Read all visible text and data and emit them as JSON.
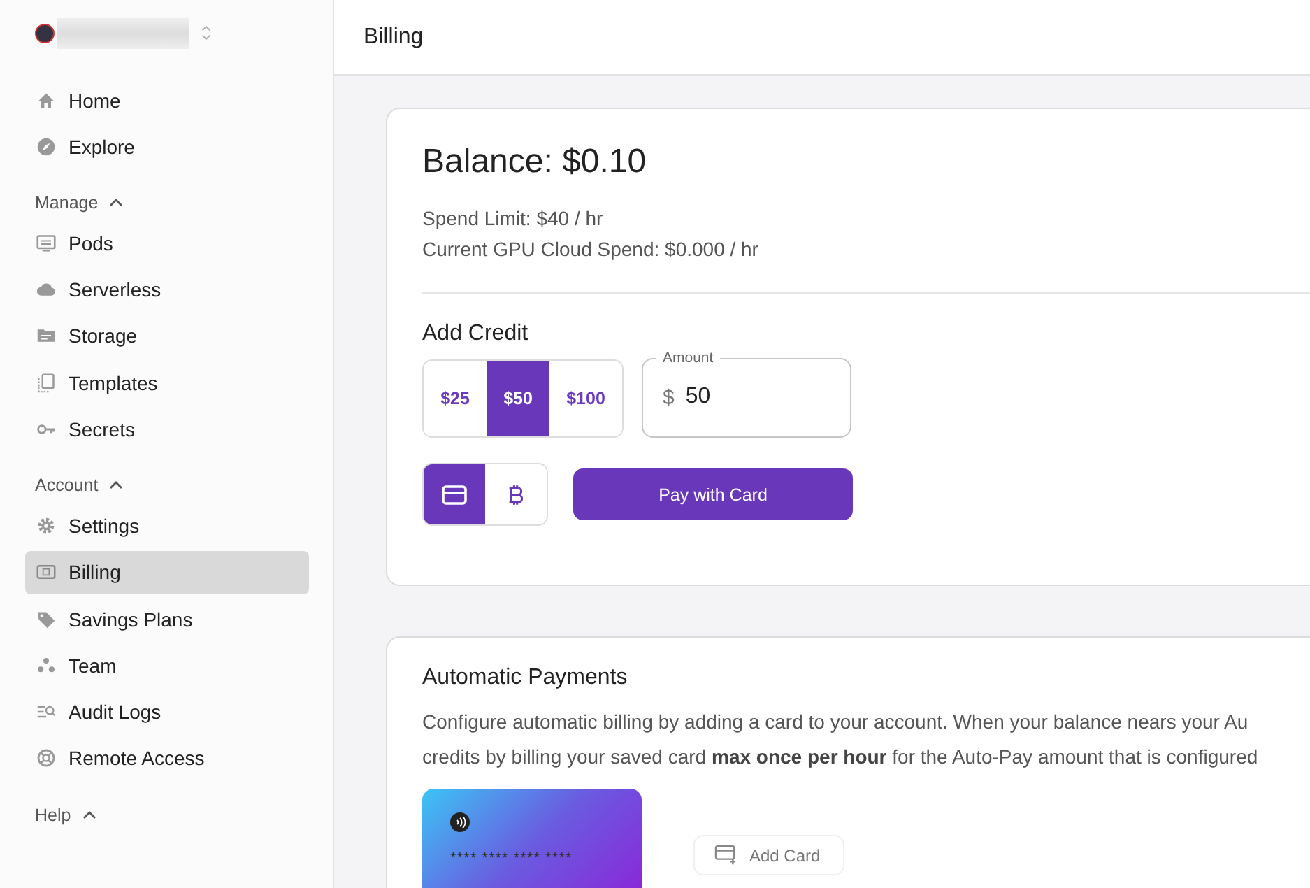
{
  "sidebar": {
    "top_items": [
      {
        "label": "Home",
        "selected": false
      },
      {
        "label": "Explore",
        "selected": false
      }
    ],
    "sections": [
      {
        "title": "Manage",
        "expanded": true,
        "items": [
          {
            "label": "Pods",
            "selected": false
          },
          {
            "label": "Serverless",
            "selected": false
          },
          {
            "label": "Storage",
            "selected": false
          },
          {
            "label": "Templates",
            "selected": false
          },
          {
            "label": "Secrets",
            "selected": false
          }
        ]
      },
      {
        "title": "Account",
        "expanded": true,
        "items": [
          {
            "label": "Settings",
            "selected": false
          },
          {
            "label": "Billing",
            "selected": true
          },
          {
            "label": "Savings Plans",
            "selected": false
          },
          {
            "label": "Team",
            "selected": false
          },
          {
            "label": "Audit Logs",
            "selected": false
          },
          {
            "label": "Remote Access",
            "selected": false
          }
        ]
      },
      {
        "title": "Help",
        "expanded": true
      }
    ]
  },
  "header": {
    "title": "Billing"
  },
  "balance_card": {
    "balance": "Balance: $0.10",
    "spend_limit": "Spend Limit: $40 / hr",
    "current_spend": "Current GPU Cloud Spend: $0.000 / hr",
    "add_credit": {
      "title": "Add Credit",
      "amounts": [
        {
          "label": "$25",
          "selected": false
        },
        {
          "label": "$50",
          "selected": true
        },
        {
          "label": "$100",
          "selected": false
        }
      ],
      "amount_field": {
        "label": "Amount",
        "prefix": "$",
        "value": "50"
      },
      "methods": [
        {
          "kind": "card",
          "selected": true
        },
        {
          "kind": "bitcoin",
          "selected": false
        }
      ],
      "pay_button": "Pay with Card"
    }
  },
  "auto_payments": {
    "title": "Automatic Payments",
    "lines": [
      "Configure automatic billing by adding a card to your account. When your balance nears your Au",
      "credits by billing your saved card **max once per hour** for the Auto-Pay amount that is configured"
    ],
    "card_number": "**** **** **** ****",
    "add_card": "Add Card"
  }
}
